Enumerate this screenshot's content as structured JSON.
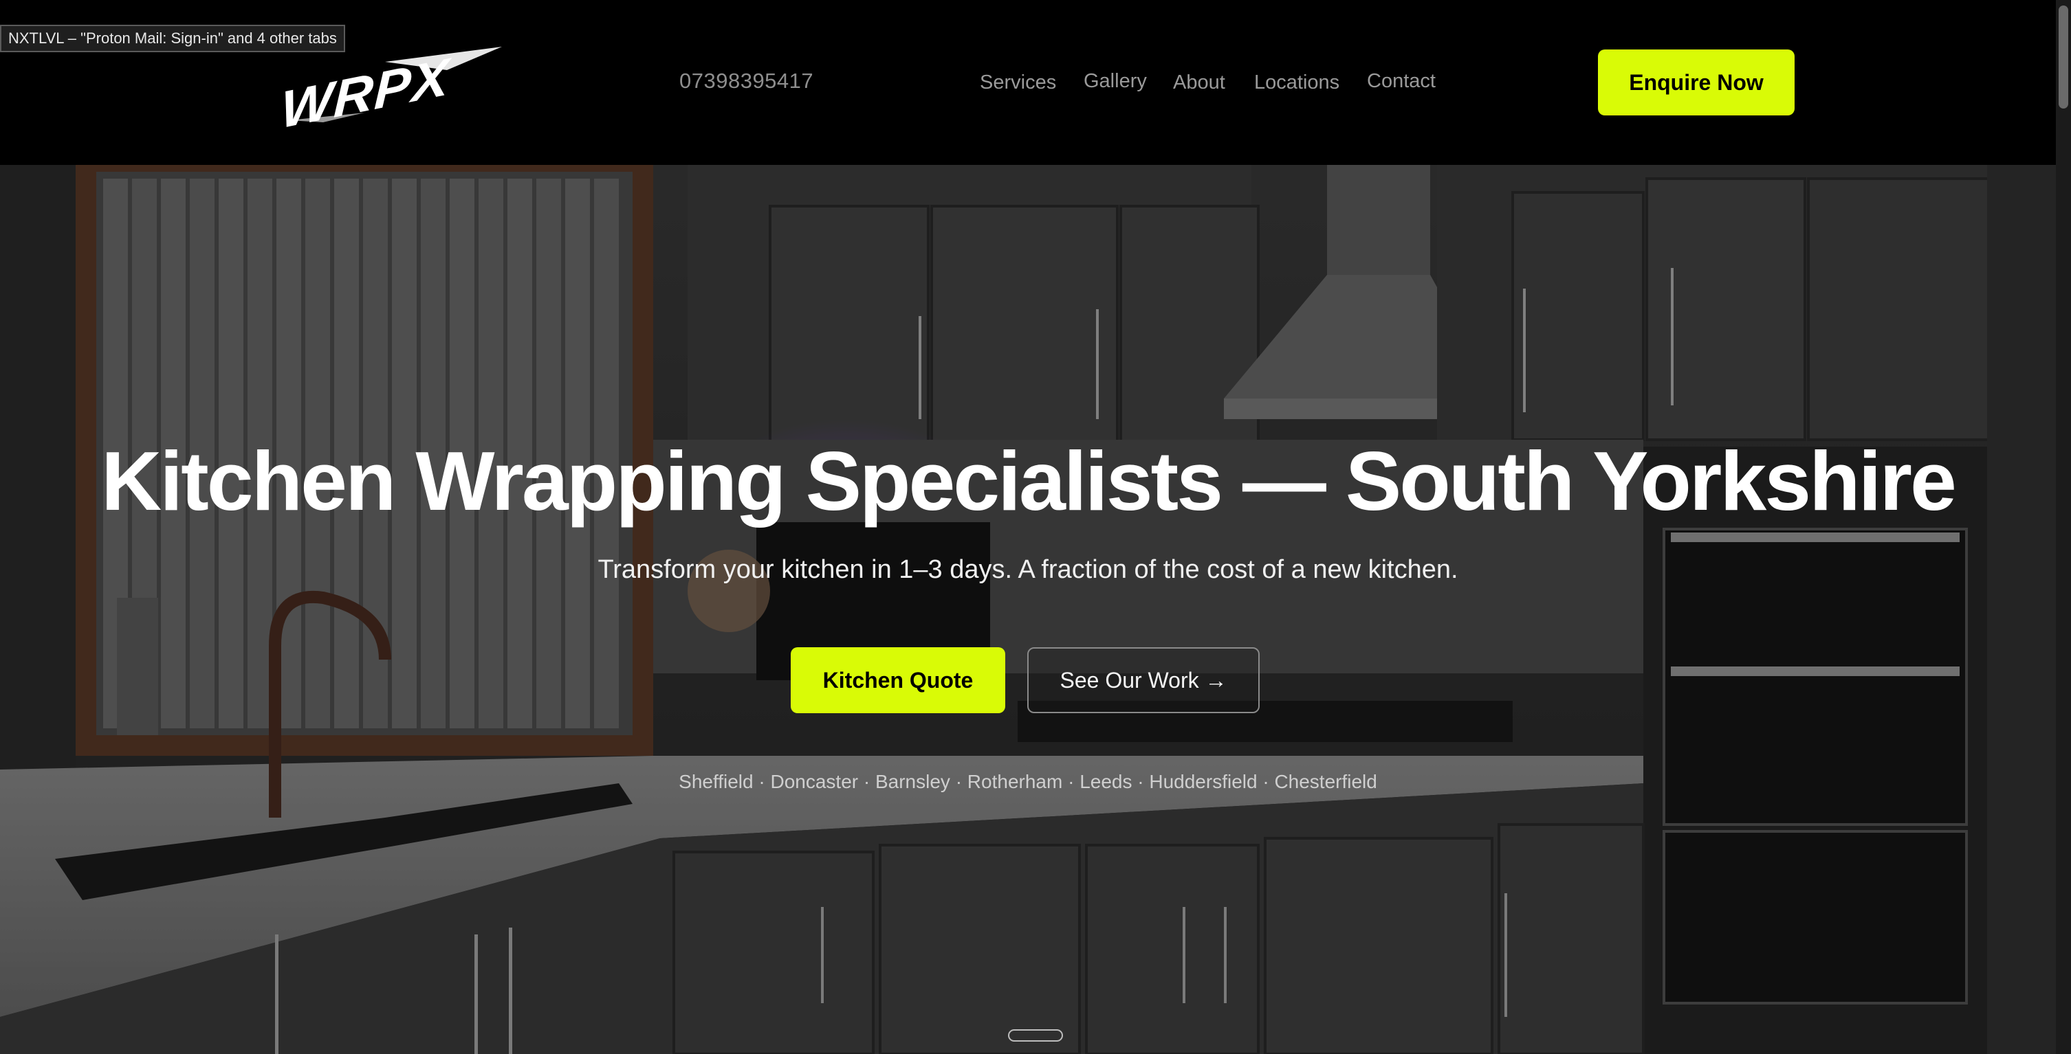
{
  "window": {
    "tab_tooltip": "NXTLVL – \"Proton Mail: Sign-in\" and 4 other tabs"
  },
  "header": {
    "logo_text": "WRPX",
    "phone": "07398395417",
    "nav": [
      {
        "label": "Services"
      },
      {
        "label": "Gallery"
      },
      {
        "label": "About"
      },
      {
        "label": "Locations"
      },
      {
        "label": "Contact"
      }
    ],
    "cta_label": "Enquire Now"
  },
  "hero": {
    "title": "Kitchen Wrapping Specialists — South Yorkshire",
    "subtitle": "Transform your kitchen in 1–3 days. A fraction of the cost of a new kitchen.",
    "primary_cta": "Kitchen Quote",
    "secondary_cta": "See Our Work →",
    "locations": "Sheffield · Doncaster · Barnsley · Rotherham · Leeds · Huddersfield · Chesterfield"
  },
  "colors": {
    "accent": "#d9fb06",
    "header_bg": "#000000",
    "nav_text": "#9a9a9a"
  }
}
